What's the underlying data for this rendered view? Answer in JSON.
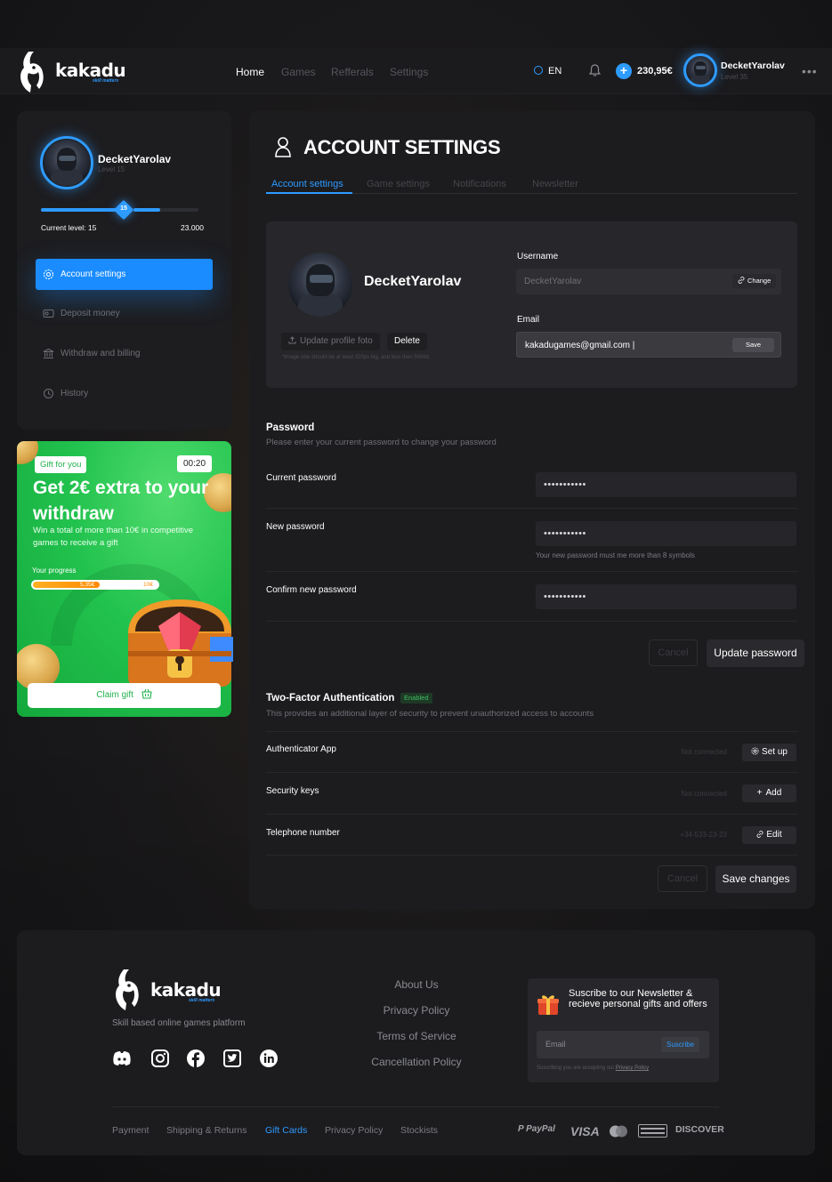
{
  "brand": {
    "name": "kakadu",
    "tagline": "skill matters"
  },
  "header": {
    "nav": [
      "Home",
      "Games",
      "Refferals",
      "Settings"
    ],
    "language": "EN",
    "balance": "230,95€",
    "user": {
      "name": "DecketYarolav",
      "level": "Level 35"
    }
  },
  "sidebar": {
    "user": {
      "name": "DecketYarolav",
      "level": "Level 15"
    },
    "level_badge": "15",
    "current_level_label": "Current level: 15",
    "max_points": "23.000",
    "level_progress": 0.52,
    "items": [
      {
        "label": "Account settings",
        "icon": "gear-icon",
        "active": true
      },
      {
        "label": "Deposit money",
        "icon": "wallet-icon",
        "active": false
      },
      {
        "label": "Withdraw and billing",
        "icon": "bank-icon",
        "active": false
      },
      {
        "label": "History",
        "icon": "history-icon",
        "active": false
      }
    ]
  },
  "gift": {
    "badge": "Gift for you",
    "timer": "00:20",
    "title": "Get 2€ extra to your withdraw",
    "description": "Win a total of more than 10€ in competitive games to receive a gift",
    "progress_label": "Your progress",
    "progress_value": "5,35€",
    "progress_max": "10€",
    "progress_fraction": 0.535,
    "claim_label": "Claim gift"
  },
  "main": {
    "title": "ACCOUNT SETTINGS",
    "tabs": [
      "Account settings",
      "Game settings",
      "Notifications",
      "Newsletter"
    ],
    "profile": {
      "name": "DecketYarolav",
      "update_photo": "Update profile foto",
      "delete": "Delete",
      "image_hint": "*Image size should be at least 320px big, and less then 500kb.",
      "username_label": "Username",
      "username_value": "DecketYarolav",
      "change_label": "Change",
      "email_label": "Email",
      "email_value": "kakadugames@gmail.com |",
      "save_label": "Save"
    },
    "password": {
      "title": "Password",
      "subtitle": "Please enter your current password to change your password",
      "current_label": "Current password",
      "current_value": "•••••••••••",
      "new_label": "New password",
      "new_value": "•••••••••••",
      "new_hint": "Your new password must me more than 8 symbols",
      "confirm_label": "Confirm new password",
      "confirm_value": "•••••••••••",
      "cancel": "Cancel",
      "update": "Update password"
    },
    "tfa": {
      "title": "Two-Factor Authentication",
      "badge": "Enabled",
      "subtitle": "This provides an additional layer of security to prevent unauthorized access to accounts",
      "rows": [
        {
          "label": "Authenticator App",
          "status": "Not connected",
          "action": "Set up"
        },
        {
          "label": "Security keys",
          "status": "Not connected",
          "action": "Add"
        },
        {
          "label": "Telephone number",
          "status": "+34-533-23-23",
          "action": "Edit"
        }
      ],
      "cancel": "Cancel",
      "save": "Save changes"
    }
  },
  "footer": {
    "tagline": "Skill based online games platform",
    "links": [
      "About Us",
      "Privacy Policy",
      "Terms of Service",
      "Cancellation Policy"
    ],
    "newsletter": {
      "title": "Suscribe to our Newsletter & recieve personal gifts and offers",
      "placeholder": "Email",
      "button": "Suscribe",
      "note": "Suscribing you are accepting out",
      "note_link": "Privacy Policy"
    },
    "bottom_links": [
      "Payment",
      "Shipping & Returns",
      "Gift Cards",
      "Privacy Policy",
      "Stockists"
    ],
    "payments": [
      "PayPal",
      "VISA",
      "DISCOVER"
    ]
  },
  "colors": {
    "accent": "#2e9bff",
    "gift_green": "#22c24e",
    "panel": "#1c1c1f"
  }
}
